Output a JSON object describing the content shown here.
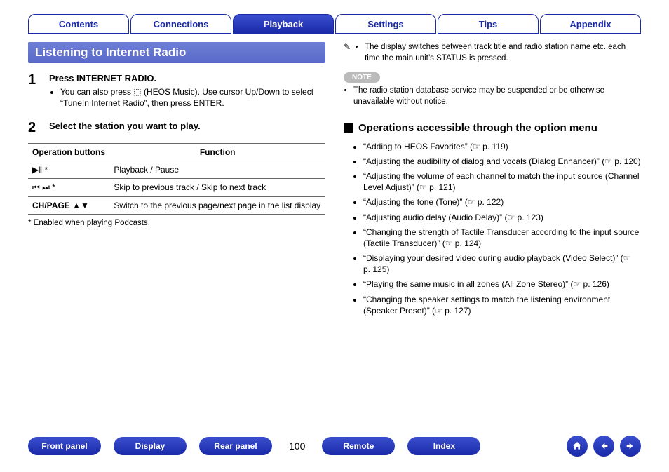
{
  "top_tabs": {
    "items": [
      "Contents",
      "Connections",
      "Playback",
      "Settings",
      "Tips",
      "Appendix"
    ],
    "active_index": 2
  },
  "left": {
    "section_title": "Listening to Internet Radio",
    "step1": {
      "num": "1",
      "title": "Press INTERNET RADIO.",
      "bullet": "You can also press ⬚ (HEOS Music). Use cursor Up/Down to select “TuneIn Internet Radio”, then press ENTER."
    },
    "step2": {
      "num": "2",
      "title": "Select the station you want to play."
    },
    "table": {
      "head": [
        "Operation buttons",
        "Function"
      ],
      "rows": [
        {
          "btn": "▶‖ *",
          "fn": "Playback / Pause"
        },
        {
          "btn": "⏮ ⏭ *",
          "fn": "Skip to previous track / Skip to next track"
        },
        {
          "btn": "CH/PAGE ▲▼",
          "fn": "Switch to the previous page/next page in the list display"
        }
      ],
      "footnote": "* Enabled when playing Podcasts."
    }
  },
  "right": {
    "pencil_bullet": "The display switches between track title and radio station name etc. each time the main unit’s STATUS is pressed.",
    "note_label": "NOTE",
    "note_bullet": "The radio station database service may be suspended or be otherwise unavailable without notice.",
    "subhead": "Operations accessible through the option menu",
    "options": [
      {
        "text": "“Adding to HEOS Favorites” (",
        "ref": "p. 119",
        "tail": ")"
      },
      {
        "text": "“Adjusting the audibility of dialog and vocals (Dialog Enhancer)” (",
        "ref": "p. 120",
        "tail": ")"
      },
      {
        "text": "“Adjusting the volume of each channel to match the input source (Channel Level Adjust)” (",
        "ref": "p. 121",
        "tail": ")"
      },
      {
        "text": "“Adjusting the tone (Tone)” (",
        "ref": "p. 122",
        "tail": ")"
      },
      {
        "text": "“Adjusting audio delay (Audio Delay)” (",
        "ref": "p. 123",
        "tail": ")"
      },
      {
        "text": "“Changing the strength of Tactile Transducer according to the input source (Tactile Transducer)” (",
        "ref": "p. 124",
        "tail": ")"
      },
      {
        "text": "“Displaying your desired video during audio playback (Video Select)” (",
        "ref": "p. 125",
        "tail": ")"
      },
      {
        "text": "“Playing the same music in all zones (All Zone Stereo)” (",
        "ref": "p. 126",
        "tail": ")"
      },
      {
        "text": "“Changing the speaker settings to match the listening environment (Speaker Preset)” (",
        "ref": "p. 127",
        "tail": ")"
      }
    ]
  },
  "bottom": {
    "pills": [
      "Front panel",
      "Display",
      "Rear panel"
    ],
    "page_no": "100",
    "pills2": [
      "Remote",
      "Index"
    ]
  }
}
